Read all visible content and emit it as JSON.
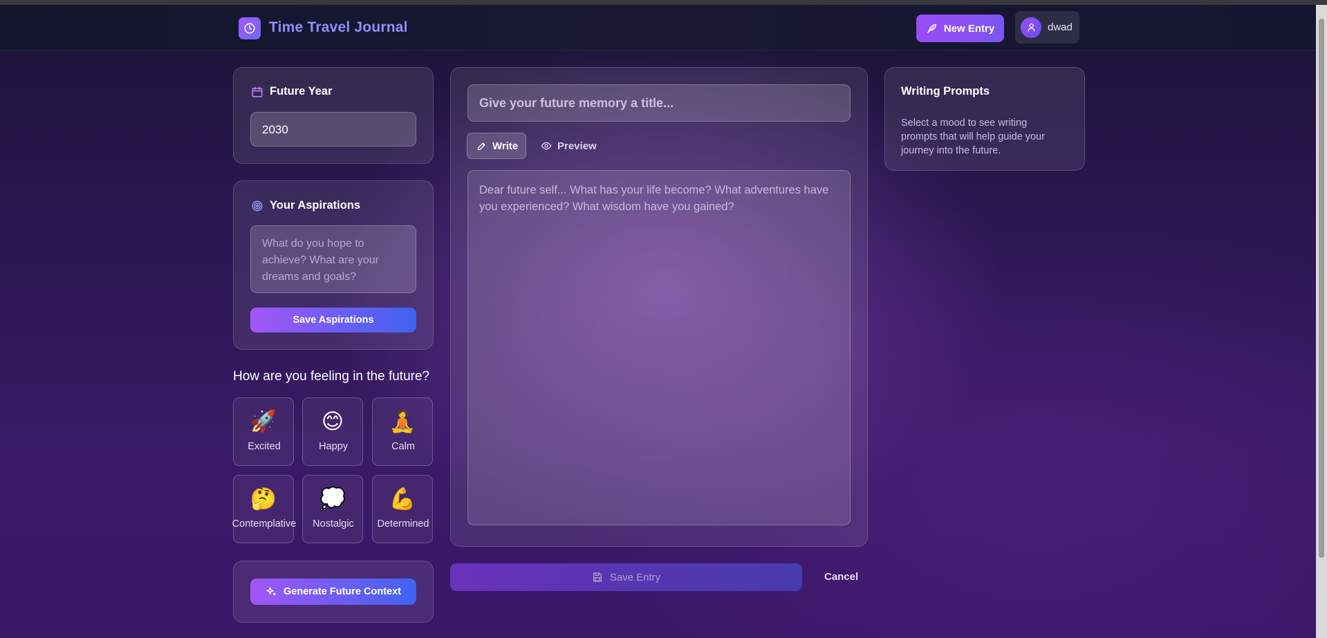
{
  "header": {
    "app_title": "Time Travel Journal",
    "new_entry_label": "New Entry",
    "user_name": "dwad"
  },
  "future_year": {
    "title": "Future Year",
    "value": "2030"
  },
  "aspirations": {
    "title": "Your Aspirations",
    "placeholder": "What do you hope to achieve? What are your dreams and goals?",
    "save_label": "Save Aspirations"
  },
  "mood": {
    "question": "How are you feeling in the future?",
    "options": [
      {
        "emoji": "🚀",
        "label": "Excited"
      },
      {
        "emoji": "😊",
        "label": "Happy"
      },
      {
        "emoji": "🧘",
        "label": "Calm"
      },
      {
        "emoji": "🤔",
        "label": "Contemplative"
      },
      {
        "emoji": "💭",
        "label": "Nostalgic"
      },
      {
        "emoji": "💪",
        "label": "Determined"
      }
    ]
  },
  "context": {
    "generate_label": "Generate Future Context"
  },
  "editor": {
    "title_placeholder": "Give your future memory a title...",
    "tab_write": "Write",
    "tab_preview": "Preview",
    "body_placeholder": "Dear future self... What has your life become? What adventures have you experienced? What wisdom have you gained?",
    "save_label": "Save Entry",
    "cancel_label": "Cancel"
  },
  "prompts": {
    "title": "Writing Prompts",
    "text": "Select a mood to see writing prompts that will help guide your journey into the future."
  },
  "icons": [
    "clock-icon",
    "feather-pen-icon",
    "user-icon",
    "calendar-icon",
    "target-icon",
    "sparkles-icon",
    "pencil-icon",
    "eye-icon",
    "save-icon"
  ],
  "colors": {
    "accent_purple": "#a356f6",
    "accent_blue": "#3f63ef",
    "title_color": "#8f8ff5"
  }
}
